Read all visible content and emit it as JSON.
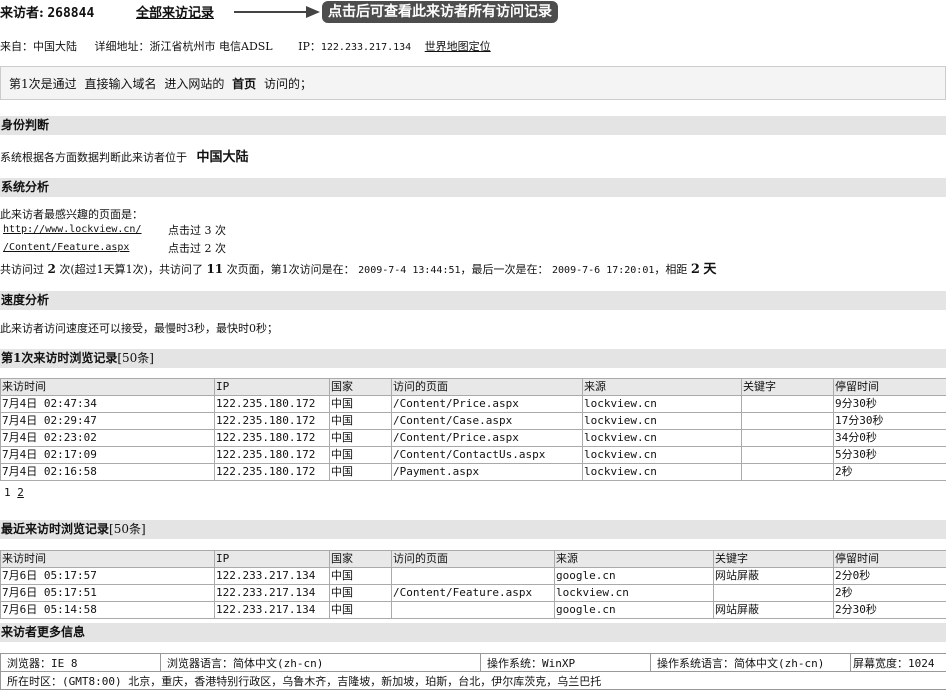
{
  "header": {
    "visitor_label": "来访者:",
    "visitor_id": "268844",
    "all_records_link": "全部来访记录",
    "tip_bubble": "点击后可查看此来访者所有访问记录"
  },
  "origin": {
    "from": "来自：中国大陆",
    "address_label": "详细地址：浙江省杭州市 电信ADSL",
    "ip_label": "IP：",
    "ip_value": "122.233.217.134",
    "map_link": "世界地图定位"
  },
  "entry": {
    "prefix": "第1次是通过",
    "method": "直接输入域名",
    "middle": "进入网站的",
    "page": "首页",
    "suffix": "访问的；"
  },
  "identity": {
    "title": "身份判断",
    "text": "系统根据各方面数据判断此来访者位于",
    "location": "中国大陆"
  },
  "analysis": {
    "title": "系统分析",
    "intro": "此来访者最感兴趣的页面是：",
    "pages": [
      {
        "url": "http://www.lockview.cn/",
        "clicks": "点击过 3 次"
      },
      {
        "url": "/Content/Feature.aspx",
        "clicks": "点击过 2 次"
      }
    ],
    "summary_1": "共访问过",
    "visits": "2",
    "summary_2": "次(超过1天算1次)，共访问了",
    "page_count": "11",
    "summary_3": "次页面，第1次访问是在：",
    "first_visit": "2009-7-4 13:44:51",
    "summary_4": "，最后一次是在：",
    "last_visit": "2009-7-6 17:20:01",
    "summary_5": "，相距",
    "days": "2",
    "days_unit": "天"
  },
  "speed": {
    "title": "速度分析",
    "text": "此来访者访问速度还可以接受，最慢时3秒，最快时0秒；"
  },
  "first_records": {
    "title": "第1次来访时浏览记录",
    "count": "[50条]",
    "headers": [
      "来访时间",
      "IP",
      "国家",
      "访问的页面",
      "来源",
      "关键字",
      "停留时间"
    ],
    "rows": [
      [
        "7月4日 02:47:34",
        "122.235.180.172",
        "中国",
        "/Content/Price.aspx",
        "lockview.cn",
        "",
        "9分30秒"
      ],
      [
        "7月4日 02:29:47",
        "122.235.180.172",
        "中国",
        "/Content/Case.aspx",
        "lockview.cn",
        "",
        "17分30秒"
      ],
      [
        "7月4日 02:23:02",
        "122.235.180.172",
        "中国",
        "/Content/Price.aspx",
        "lockview.cn",
        "",
        "34分0秒"
      ],
      [
        "7月4日 02:17:09",
        "122.235.180.172",
        "中国",
        "/Content/ContactUs.aspx",
        "lockview.cn",
        "",
        "5分30秒"
      ],
      [
        "7月4日 02:16:58",
        "122.235.180.172",
        "中国",
        "/Payment.aspx",
        "lockview.cn",
        "",
        "2秒"
      ]
    ],
    "pager": [
      "1",
      "2"
    ]
  },
  "recent_records": {
    "title": "最近来访时浏览记录",
    "count": "[50条]",
    "headers": [
      "来访时间",
      "IP",
      "国家",
      "访问的页面",
      "来源",
      "关键字",
      "停留时间"
    ],
    "rows": [
      [
        "7月6日 05:17:57",
        "122.233.217.134",
        "中国",
        "",
        "google.cn",
        "网站屏蔽",
        "2分0秒"
      ],
      [
        "7月6日 05:17:51",
        "122.233.217.134",
        "中国",
        "/Content/Feature.aspx",
        "lockview.cn",
        "",
        "2秒"
      ],
      [
        "7月6日 05:14:58",
        "122.233.217.134",
        "中国",
        "",
        "google.cn",
        "网站屏蔽",
        "2分30秒"
      ]
    ]
  },
  "more_info": {
    "title": "来访者更多信息",
    "browser": "浏览器：IE 8",
    "browser_lang": "浏览器语言：简体中文(zh-cn)",
    "os": "操作系统：WinXP",
    "os_lang": "操作系统语言：简体中文(zh-cn)",
    "screen": "屏幕宽度：1024",
    "timezone_label": "所在时区：",
    "timezone_value": "(GMT8:00) 北京，重庆，香港特别行政区，乌鲁木齐，吉隆坡，新加坡，珀斯，台北，伊尔库茨克，乌兰巴托"
  }
}
